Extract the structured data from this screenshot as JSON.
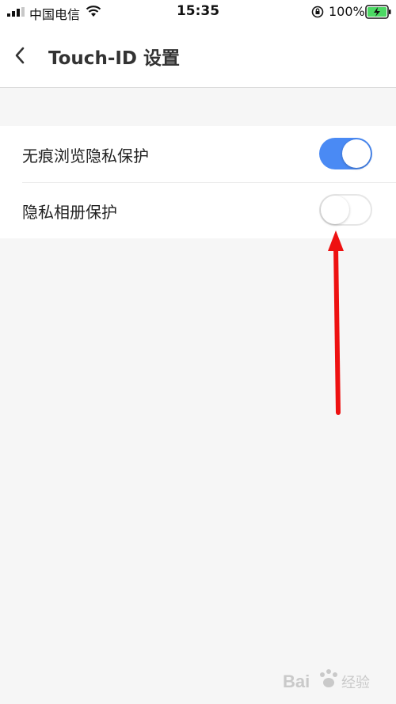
{
  "status_bar": {
    "carrier": "中国电信",
    "time": "15:35",
    "battery_percent": "100%"
  },
  "nav": {
    "title": "Touch-ID 设置"
  },
  "settings": [
    {
      "label": "无痕浏览隐私保护",
      "enabled": true
    },
    {
      "label": "隐私相册保护",
      "enabled": false
    }
  ],
  "colors": {
    "toggle_on": "#4a8af4",
    "annotation_arrow": "#ee1111"
  },
  "watermark": {
    "text": "Bai 经验"
  }
}
